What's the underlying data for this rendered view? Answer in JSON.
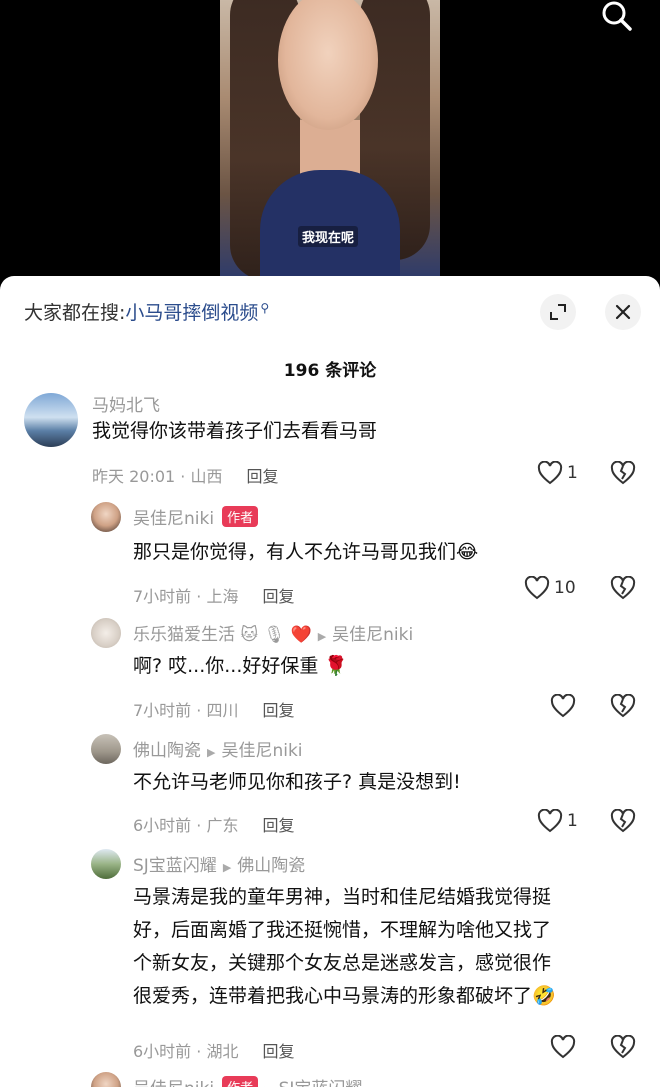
{
  "video": {
    "subtitle": "我现在呢"
  },
  "sheet": {
    "search_prefix": "大家都在搜:",
    "search_query": "小马哥摔倒视频",
    "comment_count": "196 条评论"
  },
  "comments": [
    {
      "user": "马妈北飞",
      "text": "我觉得你该带着孩子们去看看马哥",
      "time": "昨天 20:01 · 山西",
      "reply": "回复",
      "likes": "1"
    },
    {
      "user": "吴佳尼niki",
      "tag": "作者",
      "text": "那只是你觉得，有人不允许马哥见我们",
      "time": "7小时前 · 上海",
      "reply": "回复",
      "likes": "10"
    },
    {
      "user": "乐乐猫爱生活",
      "reply_to": "吴佳尼niki",
      "text": "啊? 哎...你...好好保重",
      "time": "7小时前 · 四川",
      "reply": "回复",
      "likes": ""
    },
    {
      "user": "佛山陶瓷",
      "reply_to": "吴佳尼niki",
      "text": "不允许马老师见你和孩子? 真是没想到!",
      "time": "6小时前 · 广东",
      "reply": "回复",
      "likes": "1"
    },
    {
      "user": "SJ宝蓝闪耀",
      "reply_to": "佛山陶瓷",
      "text_lines": [
        "马景涛是我的童年男神，当时和佳尼结婚我觉得挺",
        "好，后面离婚了我还挺惋惜，不理解为啥他又找了",
        "个新女友，关键那个女友总是迷惑发言，感觉很作",
        "很爱秀，连带着把我心中马景涛的形象都破坏了"
      ],
      "time": "6小时前 · 湖北",
      "reply": "回复",
      "likes": ""
    },
    {
      "user": "吴佳尼niki",
      "tag": "作者",
      "reply_to": "SJ宝蓝闪耀"
    }
  ],
  "icons": {
    "search": "search-icon",
    "expand": "expand-icon",
    "close": "close-icon",
    "like": "heart-icon",
    "dislike": "broken-heart-icon"
  },
  "colors": {
    "author_tag": "#e83b58",
    "search_link": "#2b4c8c"
  }
}
